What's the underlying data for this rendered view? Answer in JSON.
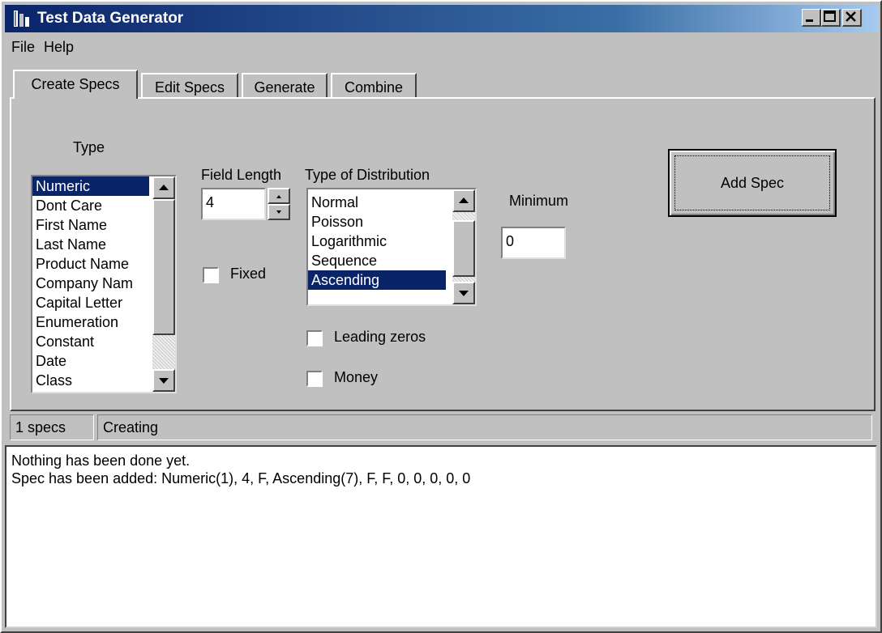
{
  "window": {
    "title": "Test Data Generator"
  },
  "menu": [
    "File",
    "Help"
  ],
  "tabs": [
    "Create Specs",
    "Edit Specs",
    "Generate",
    "Combine"
  ],
  "type_label": "Type",
  "type_list": [
    "Numeric",
    "Dont Care",
    "First Name",
    "Last Name",
    "Product Name",
    "Company Nam",
    "Capital Letter",
    "Enumeration",
    "Constant",
    "Date",
    "Class"
  ],
  "field_length": {
    "label": "Field Length",
    "value": "4"
  },
  "fixed_label": "Fixed",
  "distribution": {
    "label": "Type of Distribution",
    "items": [
      "Normal",
      "Poisson",
      "Logarithmic",
      "Sequence",
      "Ascending"
    ]
  },
  "minimum": {
    "label": "Minimum",
    "value": "0"
  },
  "leading_zeros_label": "Leading zeros",
  "money_label": "Money",
  "add_spec_label": "Add Spec",
  "status": {
    "count": "1 specs",
    "mode": "Creating"
  },
  "log": {
    "line1": "Nothing has been done yet.",
    "line2": "Spec has been added: Numeric(1), 4, F, Ascending(7), F, F, 0, 0, 0, 0, 0"
  },
  "colors": {
    "title_start": "#0a246a",
    "title_end": "#a6caf0",
    "selection": "#0a246a",
    "face": "#c0c0c0"
  },
  "icons": [
    "app-icon",
    "minimize-icon",
    "maximize-icon",
    "close-icon",
    "scroll-up-arrow-icon",
    "scroll-down-arrow-icon",
    "spin-up-icon",
    "spin-down-icon"
  ]
}
